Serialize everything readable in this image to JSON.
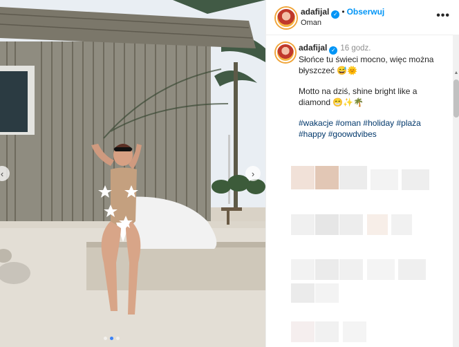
{
  "post": {
    "username": "adafijal",
    "follow_label": "Obserwuj",
    "location": "Oman",
    "more_label": "•••",
    "caption": {
      "username": "adafijal",
      "time": "16 godz.",
      "line1": "Słońce tu świeci mocno, więc można błyszczeć 😅🌞",
      "line2": "Motto na dziś, shine bright like a diamond 😁✨🌴",
      "hashtags": [
        "#wakacje",
        "#oman",
        "#holiday",
        "#plaża",
        "#happy",
        "#goowdvibes"
      ]
    }
  },
  "carousel": {
    "prev_label": "‹",
    "next_label": "›",
    "dot_count": 3,
    "active_dot": 1
  },
  "colors": {
    "accent": "#0095f6",
    "hashtag": "#00376b",
    "text": "#262626",
    "muted": "#8e8e8e"
  }
}
